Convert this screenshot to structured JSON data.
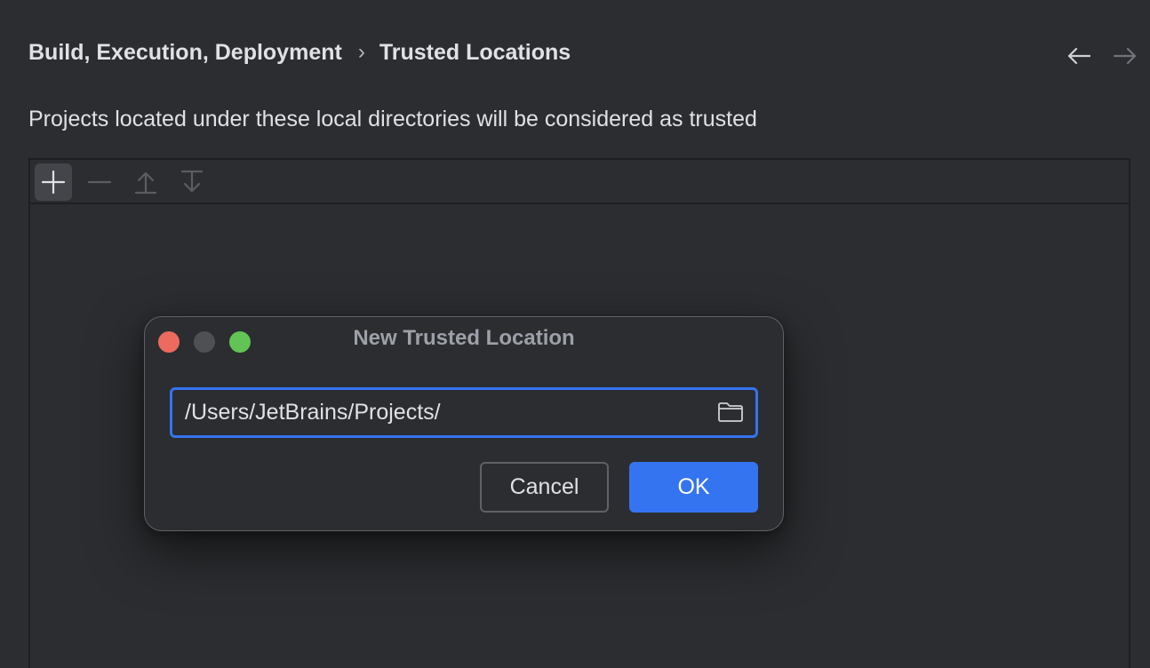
{
  "breadcrumb": {
    "parent": "Build, Execution, Deployment",
    "separator": "›",
    "current": "Trusted Locations"
  },
  "nav": {
    "back_icon": "arrow-left-icon",
    "forward_icon": "arrow-right-icon"
  },
  "description": "Projects located under these local directories will be considered as trusted",
  "toolbar": {
    "add_icon": "plus-icon",
    "remove_icon": "minus-icon",
    "move_up_icon": "move-up-icon",
    "move_down_icon": "move-down-icon"
  },
  "dialog": {
    "title": "New Trusted Location",
    "path_value": "/Users/JetBrains/Projects/",
    "browse_icon": "folder-icon",
    "cancel_label": "Cancel",
    "ok_label": "OK"
  },
  "colors": {
    "background": "#2b2d30",
    "accent": "#3574f0",
    "close": "#ec6a5e",
    "minimize_inactive": "#4e5054",
    "maximize": "#61c454"
  }
}
